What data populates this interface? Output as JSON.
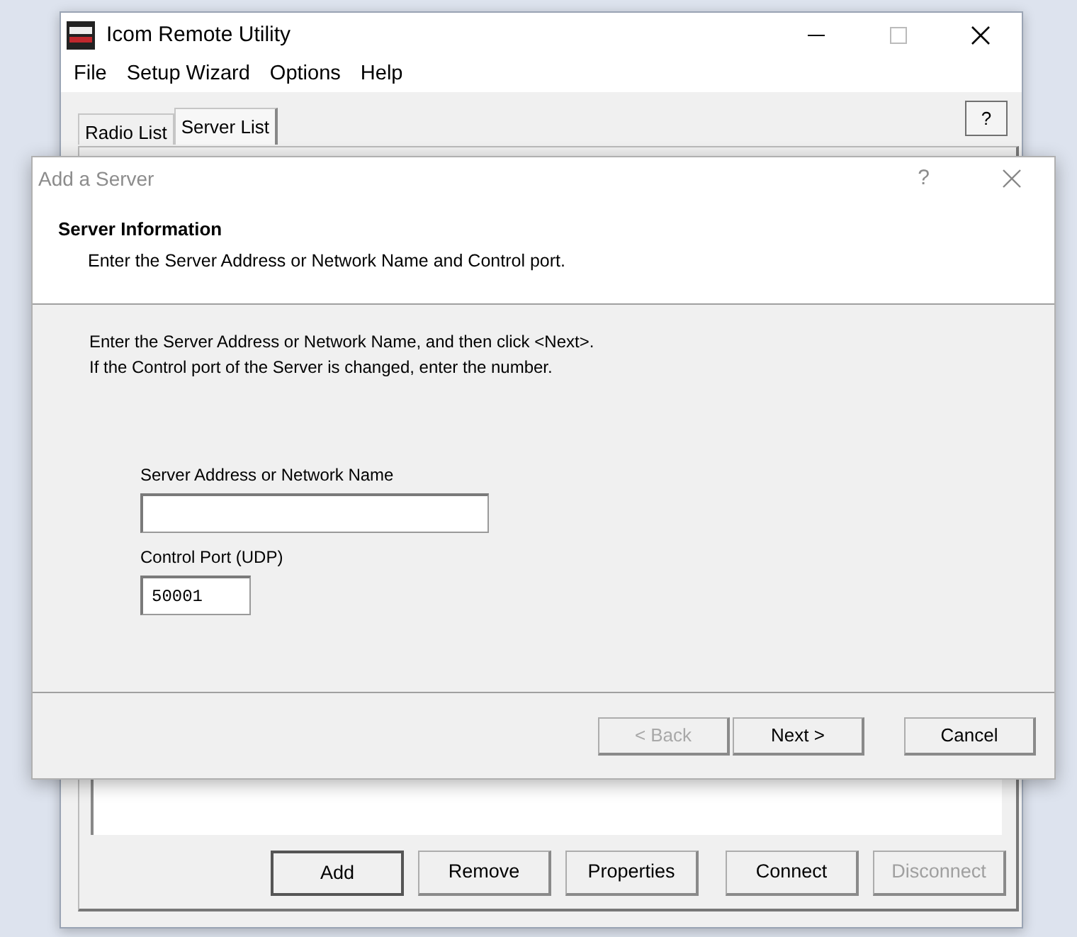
{
  "main_window": {
    "title": "Icom Remote Utility",
    "menu": [
      "File",
      "Setup Wizard",
      "Options",
      "Help"
    ],
    "tabs": [
      {
        "label": "Radio List",
        "selected": false
      },
      {
        "label": "Server List",
        "selected": true
      }
    ],
    "help_button": "?",
    "buttons": [
      {
        "label": "Add",
        "disabled": false,
        "focused": true
      },
      {
        "label": "Remove",
        "disabled": false,
        "focused": false
      },
      {
        "label": "Properties",
        "disabled": false,
        "focused": false
      },
      {
        "label": "Connect",
        "disabled": false,
        "focused": false
      },
      {
        "label": "Disconnect",
        "disabled": true,
        "focused": false
      }
    ]
  },
  "dialog": {
    "title": "Add a Server",
    "help_button": "?",
    "header_title": "Server Information",
    "header_subtitle": "Enter the Server Address or Network Name and Control port.",
    "instructions": [
      "Enter the Server Address or Network Name, and then click <Next>.",
      "If the Control port of the Server is changed, enter the number."
    ],
    "fields": [
      {
        "label": "Server Address or Network Name"
      },
      {
        "label": "Control Port (UDP)",
        "value": "50001"
      }
    ],
    "buttons": [
      {
        "label": "< Back",
        "disabled": true
      },
      {
        "label": "Next >",
        "disabled": false
      },
      {
        "label": "Cancel",
        "disabled": false
      }
    ]
  }
}
